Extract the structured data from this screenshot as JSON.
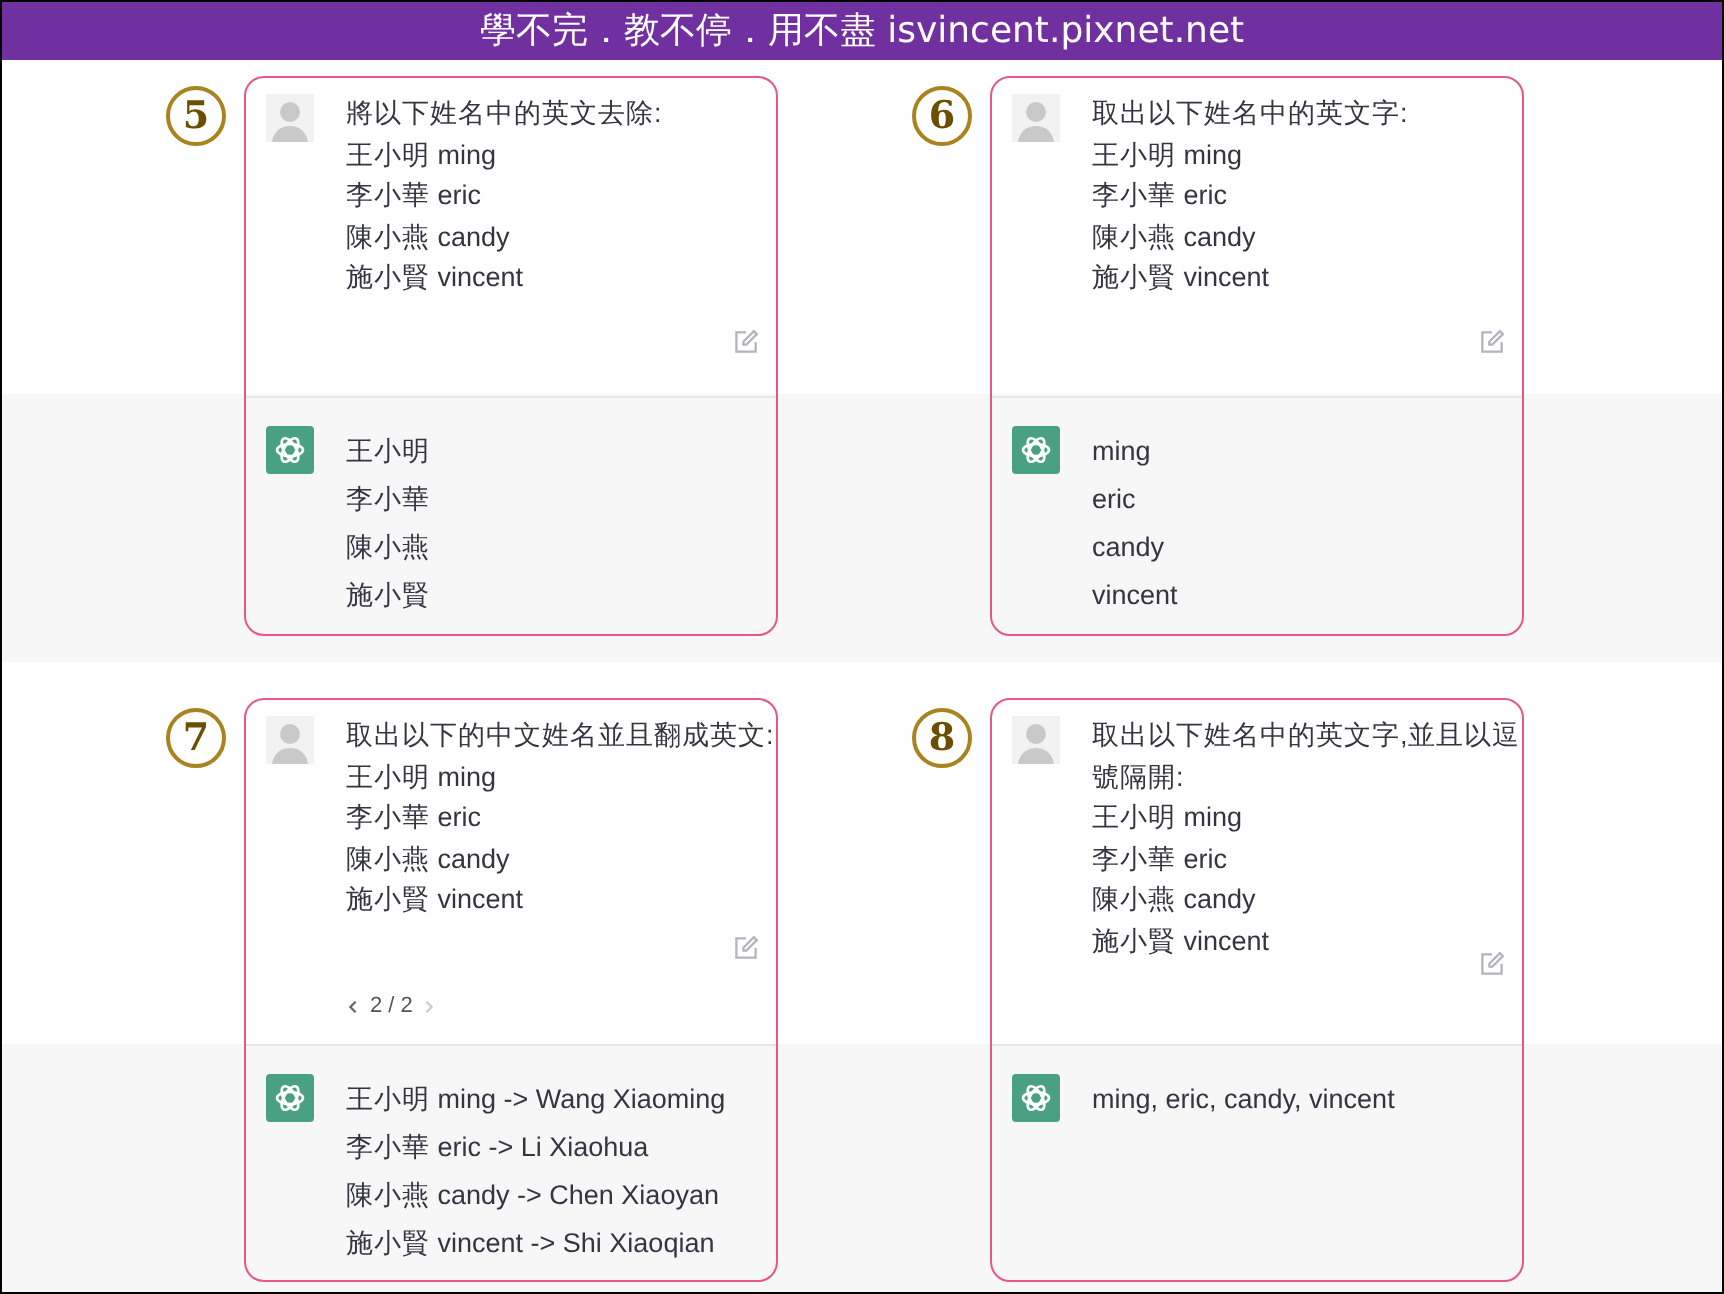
{
  "header": {
    "title": "學不完．教不停．用不盡 isvincent.pixnet.net"
  },
  "panels": [
    {
      "number": "5",
      "prompt": [
        "將以下姓名中的英文去除:",
        "王小明 ming",
        "李小華 eric",
        "陳小燕 candy",
        "施小賢 vincent"
      ],
      "response": [
        "王小明",
        "李小華",
        "陳小燕",
        "施小賢"
      ]
    },
    {
      "number": "6",
      "prompt": [
        "取出以下姓名中的英文字:",
        "王小明 ming",
        "李小華 eric",
        "陳小燕 candy",
        "施小賢 vincent"
      ],
      "response": [
        "ming",
        "eric",
        "candy",
        "vincent"
      ]
    },
    {
      "number": "7",
      "prompt": [
        "取出以下的中文姓名並且翻成英文:",
        "王小明 ming",
        "李小華 eric",
        "陳小燕 candy",
        "施小賢 vincent"
      ],
      "pager": {
        "text": "2 / 2",
        "prev_disabled": false,
        "next_disabled": true
      },
      "response": [
        "王小明 ming -> Wang Xiaoming",
        "李小華 eric -> Li Xiaohua",
        "陳小燕 candy -> Chen Xiaoyan",
        "施小賢 vincent -> Shi Xiaoqian"
      ]
    },
    {
      "number": "8",
      "prompt": [
        "取出以下姓名中的英文字,並且以逗號隔開:",
        "王小明 ming",
        "李小華 eric",
        "陳小燕 candy",
        "施小賢 vincent"
      ],
      "response": [
        "ming, eric, candy, vincent"
      ]
    }
  ]
}
